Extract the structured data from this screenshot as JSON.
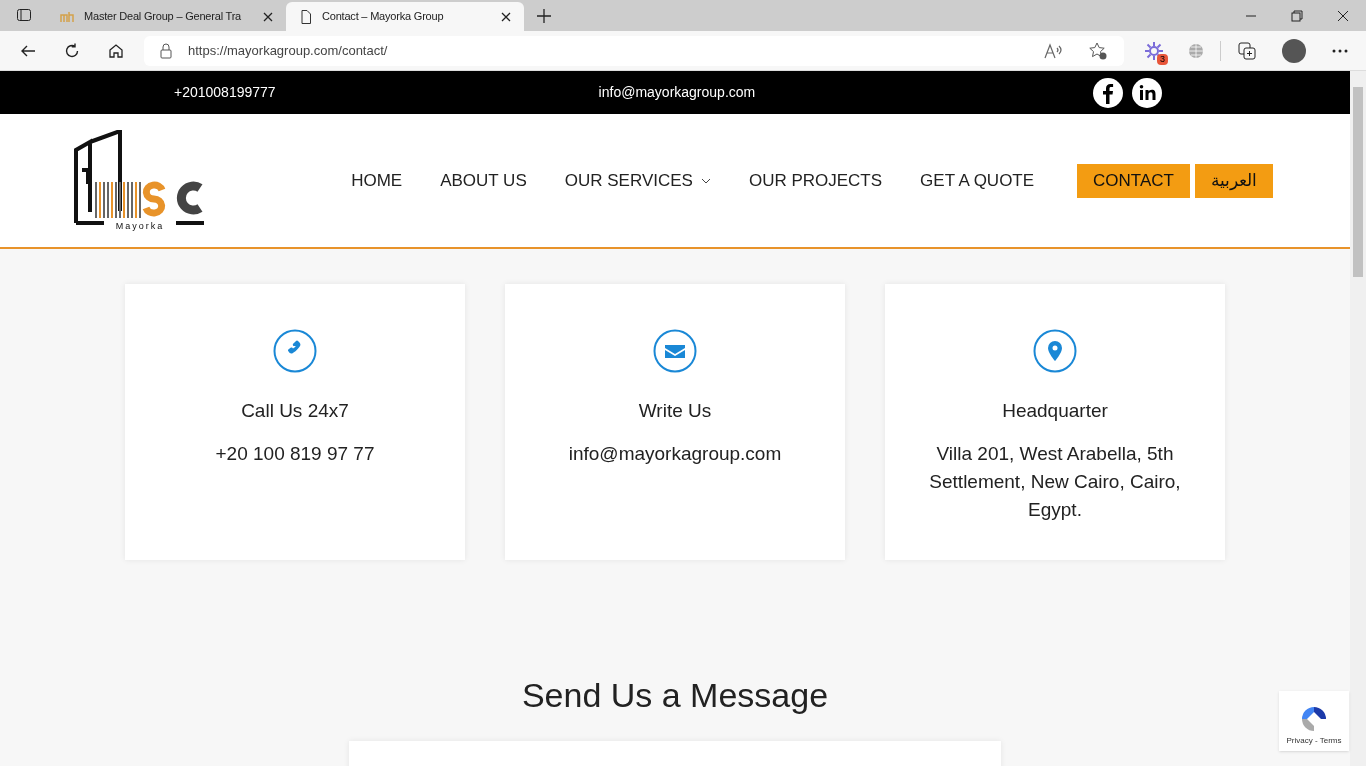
{
  "browser": {
    "tabs": [
      {
        "title": "Master Deal Group – General Tra",
        "selected": false
      },
      {
        "title": "Contact – Mayorka Group",
        "selected": true
      }
    ],
    "address": "https://mayorkagroup.com/contact/",
    "extension_badge": "3"
  },
  "top_bar": {
    "phone": "+201008199777",
    "email": "info@mayorkagroup.com"
  },
  "logo": {
    "name": "Mayorka"
  },
  "nav": [
    {
      "label": "HOME",
      "kind": "link"
    },
    {
      "label": "ABOUT US",
      "kind": "link"
    },
    {
      "label": "OUR SERVICES",
      "kind": "dropdown"
    },
    {
      "label": "OUR PROJECTS",
      "kind": "link"
    },
    {
      "label": "GET A QUOTE",
      "kind": "link"
    },
    {
      "label": "CONTACT",
      "kind": "button"
    },
    {
      "label": "العربية",
      "kind": "button"
    }
  ],
  "cards": [
    {
      "kind": "phone",
      "title": "Call Us 24x7",
      "text": "+20 100 819 97 77"
    },
    {
      "kind": "mail",
      "title": "Write Us",
      "text": "info@mayorkagroup.com"
    },
    {
      "kind": "pin",
      "title": "Headquarter",
      "text": "Villa 201, West Arabella, 5th Settlement, New Cairo, Cairo, Egypt."
    }
  ],
  "form": {
    "heading": "Send Us a Message"
  },
  "recaptcha": {
    "links": "Privacy - Terms"
  }
}
